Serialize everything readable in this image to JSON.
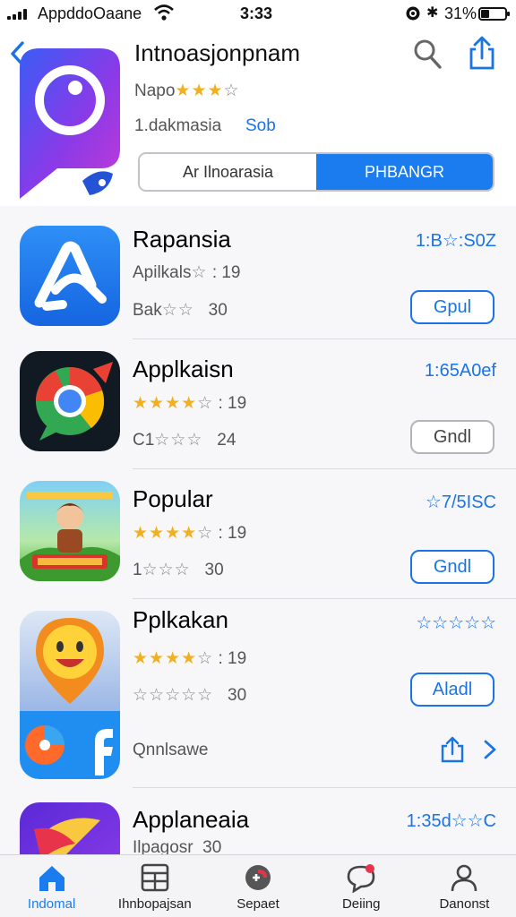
{
  "status_bar": {
    "carrier": "AppddoOaane",
    "time": "3:33",
    "battery_pct": "31%",
    "battery_level": 0.31,
    "icons": [
      "signal-icon",
      "wifi-icon",
      "alarm-icon",
      "bluetooth-icon",
      "battery-icon"
    ]
  },
  "header": {
    "title": "Intnoasjonpnam",
    "rating_label": "Napo",
    "rating_stars": "★★★",
    "rating_hollow": "☆",
    "meta": "1.dakmasia",
    "meta_link": "Sob",
    "segments": [
      {
        "label": "Ar Ilnoarasia",
        "active": false
      },
      {
        "label": "PHBANGR",
        "active": true
      }
    ],
    "icons": [
      "back-chevron-icon",
      "search-icon",
      "share-icon"
    ]
  },
  "apps": [
    {
      "name": "Rapansia",
      "line1_prefix": "Apilkals",
      "line1_stars": "",
      "line1_hollow": "☆",
      "line1_suffix": ": 19",
      "line2_prefix": "Bak",
      "line2_hollow": "☆☆",
      "line2_suffix": "30",
      "price": "1:B☆:S0Z",
      "button": "Gpul",
      "button_style": "blue"
    },
    {
      "name": "Applkaisn",
      "line1_prefix": "",
      "line1_stars": "★★★★",
      "line1_hollow": "☆",
      "line1_suffix": ": 19",
      "line2_prefix": "C1",
      "line2_hollow": "☆☆☆",
      "line2_suffix": "24",
      "price": "1:65A0ef",
      "button": "Gndl",
      "button_style": "grey"
    },
    {
      "name": "Popular",
      "line1_prefix": "",
      "line1_stars": "★★★★",
      "line1_hollow": "☆",
      "line1_suffix": ": 19",
      "line2_prefix": "1",
      "line2_hollow": "☆☆☆",
      "line2_suffix": "30",
      "price": "☆7/5ISC",
      "button": "Gndl",
      "button_style": "blue"
    },
    {
      "name": "Pplkakan",
      "line1_prefix": "",
      "line1_stars": "★★★★",
      "line1_hollow": "☆",
      "line1_suffix": ": 19",
      "line2_prefix": "",
      "line2_hollow": "☆☆☆☆☆",
      "line2_suffix": "30",
      "price": "☆☆☆☆☆",
      "button": "Aladl",
      "button_style": "blue",
      "extra": "Qnnlsawe"
    },
    {
      "name": "Applaneaia",
      "line1_prefix": "Ilpagosr",
      "line1_stars": "",
      "line1_hollow": "",
      "line1_suffix": "30",
      "price": "1:35d☆☆C"
    }
  ],
  "tabs": [
    {
      "label": "Indomal",
      "icon": "home-icon",
      "active": true
    },
    {
      "label": "Ihnbopajsan",
      "icon": "grid-icon",
      "active": false
    },
    {
      "label": "Sepaet",
      "icon": "games-icon",
      "active": false
    },
    {
      "label": "Deiing",
      "icon": "chat-icon",
      "active": false
    },
    {
      "label": "Danonst",
      "icon": "person-icon",
      "active": false
    }
  ],
  "colors": {
    "accent": "#1b7cf0",
    "star": "#f2b01e",
    "background": "#f7f7f9"
  }
}
